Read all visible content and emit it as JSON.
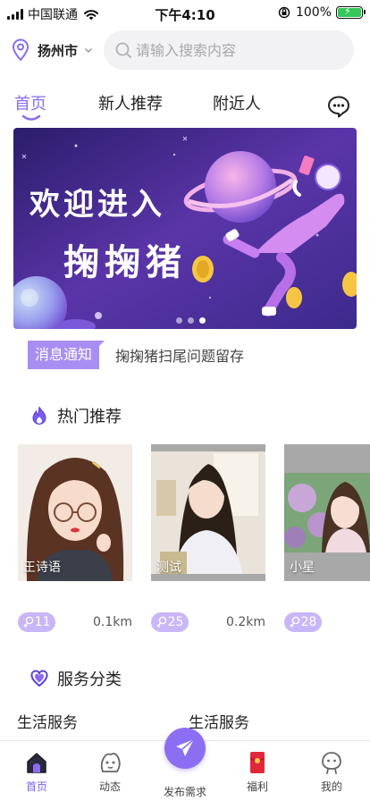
{
  "status_bar": {
    "carrier": "中国联通",
    "time": "下午4:10",
    "battery": "100%"
  },
  "header": {
    "city": "扬州市",
    "search_placeholder": "请输入搜索内容"
  },
  "tabs": [
    {
      "label": "首页",
      "active": true
    },
    {
      "label": "新人推荐",
      "active": false
    },
    {
      "label": "附近人",
      "active": false
    }
  ],
  "banner": {
    "line1": "欢迎进入",
    "line2": "掬掬猪",
    "slides": 3,
    "active_slide": 2
  },
  "notice": {
    "tag": "消息通知",
    "text": "掬掬猪扫尾问题留存"
  },
  "hot_section": {
    "title": "热门推荐",
    "cards": [
      {
        "name": "王诗语",
        "age": "11",
        "distance": "0.1km"
      },
      {
        "name": "测试",
        "age": "25",
        "distance": "0.2km"
      },
      {
        "name": "小星",
        "age": "28",
        "distance": ""
      }
    ]
  },
  "service_section": {
    "title": "服务分类",
    "items": [
      "生活服务",
      "生活服务"
    ]
  },
  "bottom_nav": [
    {
      "label": "首页",
      "icon": "home-icon",
      "active": true
    },
    {
      "label": "动态",
      "icon": "moments-icon",
      "active": false
    },
    {
      "label": "发布需求",
      "icon": "paper-plane-icon",
      "active": false
    },
    {
      "label": "福利",
      "icon": "red-envelope-icon",
      "active": false
    },
    {
      "label": "我的",
      "icon": "profile-icon",
      "active": false
    }
  ],
  "colors": {
    "accent": "#8b6cf0",
    "badge": "#c9b6f8",
    "notice_tag": "#a88ef3",
    "banner_bg": "#4b2f8f"
  }
}
